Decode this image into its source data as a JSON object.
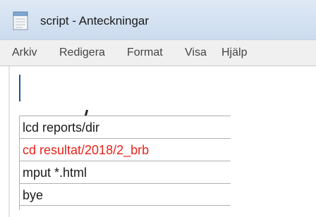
{
  "window": {
    "title": "script - Anteckningar",
    "icon": "notepad-icon"
  },
  "menu": {
    "items": [
      "Arkiv",
      "Redigera",
      "Format",
      "Visa",
      "Hjälp"
    ]
  },
  "document": {
    "lines": [
      {
        "text": "lcd reports/dir",
        "color": "#1a1a1a"
      },
      {
        "text": "cd resultat/2018/2_brb",
        "color": "#e8231a"
      },
      {
        "text": "mput *.html",
        "color": "#1a1a1a"
      },
      {
        "text": "bye",
        "color": "#1a1a1a"
      }
    ]
  }
}
